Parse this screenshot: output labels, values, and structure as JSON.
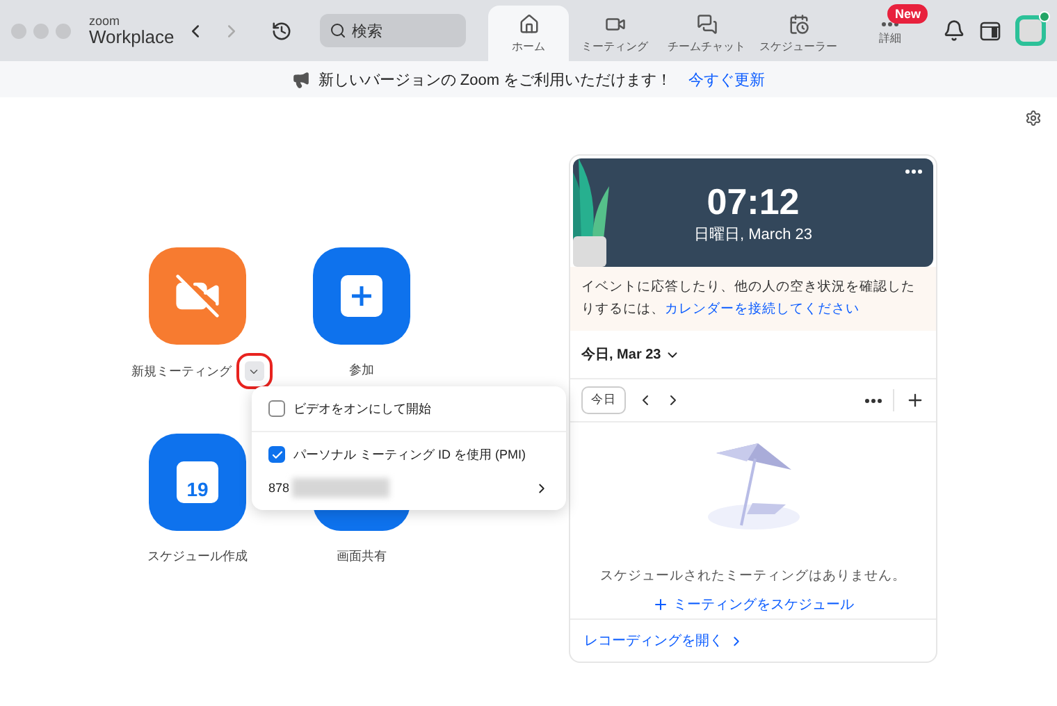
{
  "window": {
    "brand_small": "zoom",
    "brand": "Workplace"
  },
  "toolbar": {
    "search_placeholder": "検索"
  },
  "tabs": [
    {
      "label": "ホーム",
      "selected": true
    },
    {
      "label": "ミーティング",
      "selected": false
    },
    {
      "label": "チームチャット",
      "selected": false
    },
    {
      "label": "スケジューラー",
      "selected": false
    },
    {
      "label": "詳細",
      "selected": false,
      "badge": "New"
    }
  ],
  "banner": {
    "text": "新しいバージョンの Zoom をご利用いただけます！",
    "link": "今すぐ更新"
  },
  "actions": [
    {
      "label": "新規ミーティング",
      "color": "#f77b30",
      "dropdown": true
    },
    {
      "label": "参加",
      "color": "#0e72ed"
    },
    {
      "label": "スケジュール作成",
      "day": "19",
      "color": "#0e72ed"
    },
    {
      "label": "画面共有",
      "color": "#0e72ed"
    }
  ],
  "menu": {
    "items": [
      {
        "kind": "checkbox",
        "label": "ビデオをオンにして開始",
        "checked": false
      },
      {
        "kind": "checkbox",
        "label": "パーソナル ミーティング ID を使用 (PMI)",
        "checked": true
      },
      {
        "kind": "pmi",
        "label": "878"
      }
    ]
  },
  "clock": {
    "time": "07:12",
    "date": "日曜日, March 23"
  },
  "calendar_notice": {
    "text": "イベントに応答したり、他の人の空き状況を確認したりするには、",
    "link": "カレンダーを接続してください"
  },
  "date_selector": "今日, Mar 23",
  "today_button": "今日",
  "empty": {
    "message": "スケジュールされたミーティングはありません。",
    "action": "ミーティングをスケジュール"
  },
  "recordings_link": "レコーディングを開く"
}
